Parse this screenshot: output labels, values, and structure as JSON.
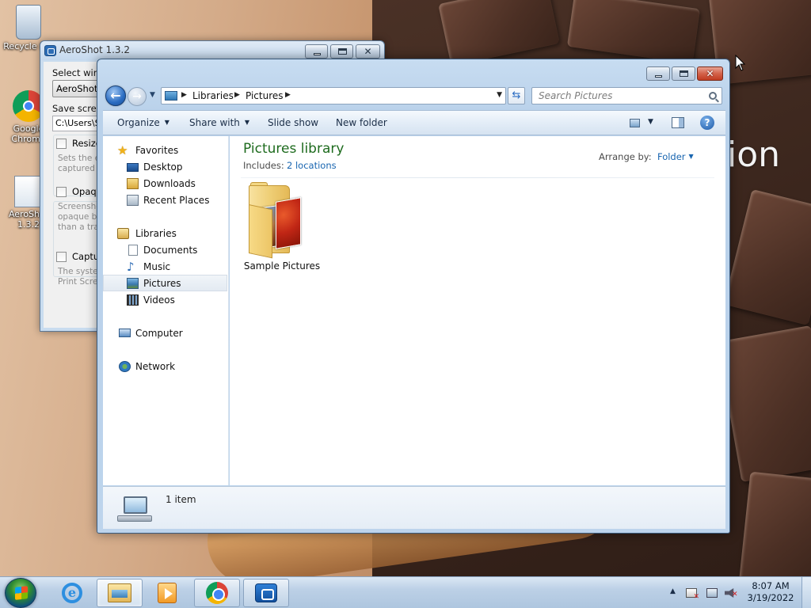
{
  "desktop": {
    "icons": [
      {
        "label": "Recycle Bin",
        "icon": "recycle-bin-icon"
      },
      {
        "label": "Google Chrome",
        "icon": "chrome-icon"
      },
      {
        "label": "AeroShot 1.3.2",
        "icon": "aeroshot-icon"
      }
    ],
    "wallpaper_text": "ion"
  },
  "aeroshot": {
    "title": "AeroShot 1.3.2",
    "select_window_label": "Select wind",
    "window_combo_value": "AeroShot 1",
    "save_label": "Save screen",
    "save_path": "C:\\Users\\St",
    "resize_label": "Resize",
    "resize_desc": "Sets the e captured",
    "opaque_label": "Opaqu",
    "opaque_desc": "Screensho opaque b than a tra",
    "capture_label": "Captu",
    "capture_desc": "The syster Print Scre"
  },
  "explorer": {
    "breadcrumb": [
      "Libraries",
      "Pictures"
    ],
    "search_placeholder": "Search Pictures",
    "toolbar": {
      "organize": "Organize",
      "share_with": "Share with",
      "slide_show": "Slide show",
      "new_folder": "New folder"
    },
    "nav": {
      "favorites": "Favorites",
      "desktop": "Desktop",
      "downloads": "Downloads",
      "recent_places": "Recent Places",
      "libraries": "Libraries",
      "documents": "Documents",
      "music": "Music",
      "pictures": "Pictures",
      "videos": "Videos",
      "computer": "Computer",
      "network": "Network"
    },
    "selected_nav": "Pictures",
    "library_title": "Pictures library",
    "includes_label": "Includes:",
    "includes_link": "2 locations",
    "arrange_label": "Arrange by:",
    "arrange_value": "Folder",
    "items": [
      {
        "name": "Sample Pictures",
        "type": "folder"
      }
    ],
    "details_count": "1 item"
  },
  "taskbar": {
    "apps": [
      {
        "name": "Internet Explorer",
        "icon": "ie-icon",
        "state": "pinned"
      },
      {
        "name": "Windows Explorer",
        "icon": "folder-icon",
        "state": "active"
      },
      {
        "name": "Windows Media Player",
        "icon": "media-player-icon",
        "state": "pinned"
      },
      {
        "name": "Google Chrome",
        "icon": "chrome-icon",
        "state": "open"
      },
      {
        "name": "AeroShot",
        "icon": "aeroshot-icon",
        "state": "open"
      }
    ],
    "time": "8:07 AM",
    "date": "3/19/2022"
  },
  "colors": {
    "library_title": "#1e6b1e",
    "link": "#1865b0",
    "close_button": "#c13c22"
  }
}
